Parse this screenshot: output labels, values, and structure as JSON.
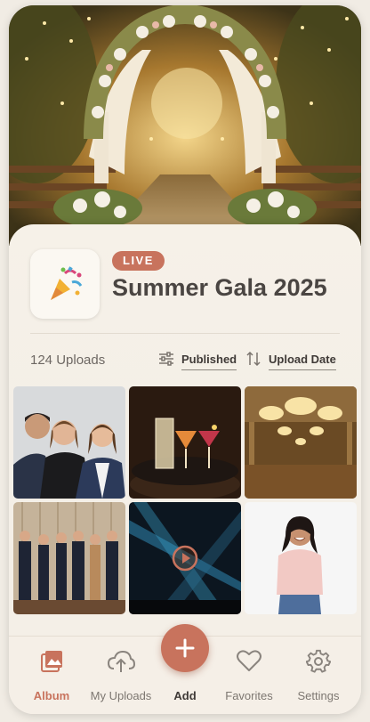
{
  "event": {
    "status_badge": "LIVE",
    "title": "Summer Gala 2025",
    "icon": "party-popper-emoji",
    "icon_glyph": "🎉"
  },
  "toolbar": {
    "uploads_count": "124 Uploads",
    "filter_label": "Published",
    "sort_label": "Upload Date"
  },
  "gallery": {
    "items": [
      {
        "type": "photo",
        "subject": "team portrait of three people"
      },
      {
        "type": "photo",
        "subject": "cocktails on tray"
      },
      {
        "type": "photo",
        "subject": "ballroom with chandeliers"
      },
      {
        "type": "photo",
        "subject": "group photo at event"
      },
      {
        "type": "video",
        "subject": "stage lights",
        "icon": "play-icon"
      },
      {
        "type": "photo",
        "subject": "smiling woman sitting"
      }
    ]
  },
  "nav": {
    "items": [
      {
        "label": "Album",
        "icon": "album-icon",
        "active": true
      },
      {
        "label": "My Uploads",
        "icon": "cloud-upload-icon",
        "active": false
      },
      {
        "label": "Add",
        "icon": "plus-icon",
        "active": false
      },
      {
        "label": "Favorites",
        "icon": "heart-icon",
        "active": false
      },
      {
        "label": "Settings",
        "icon": "gear-icon",
        "active": false
      }
    ]
  },
  "colors": {
    "accent": "#c8735d",
    "text_dark": "#3f3a37",
    "background": "#f4efe7"
  }
}
